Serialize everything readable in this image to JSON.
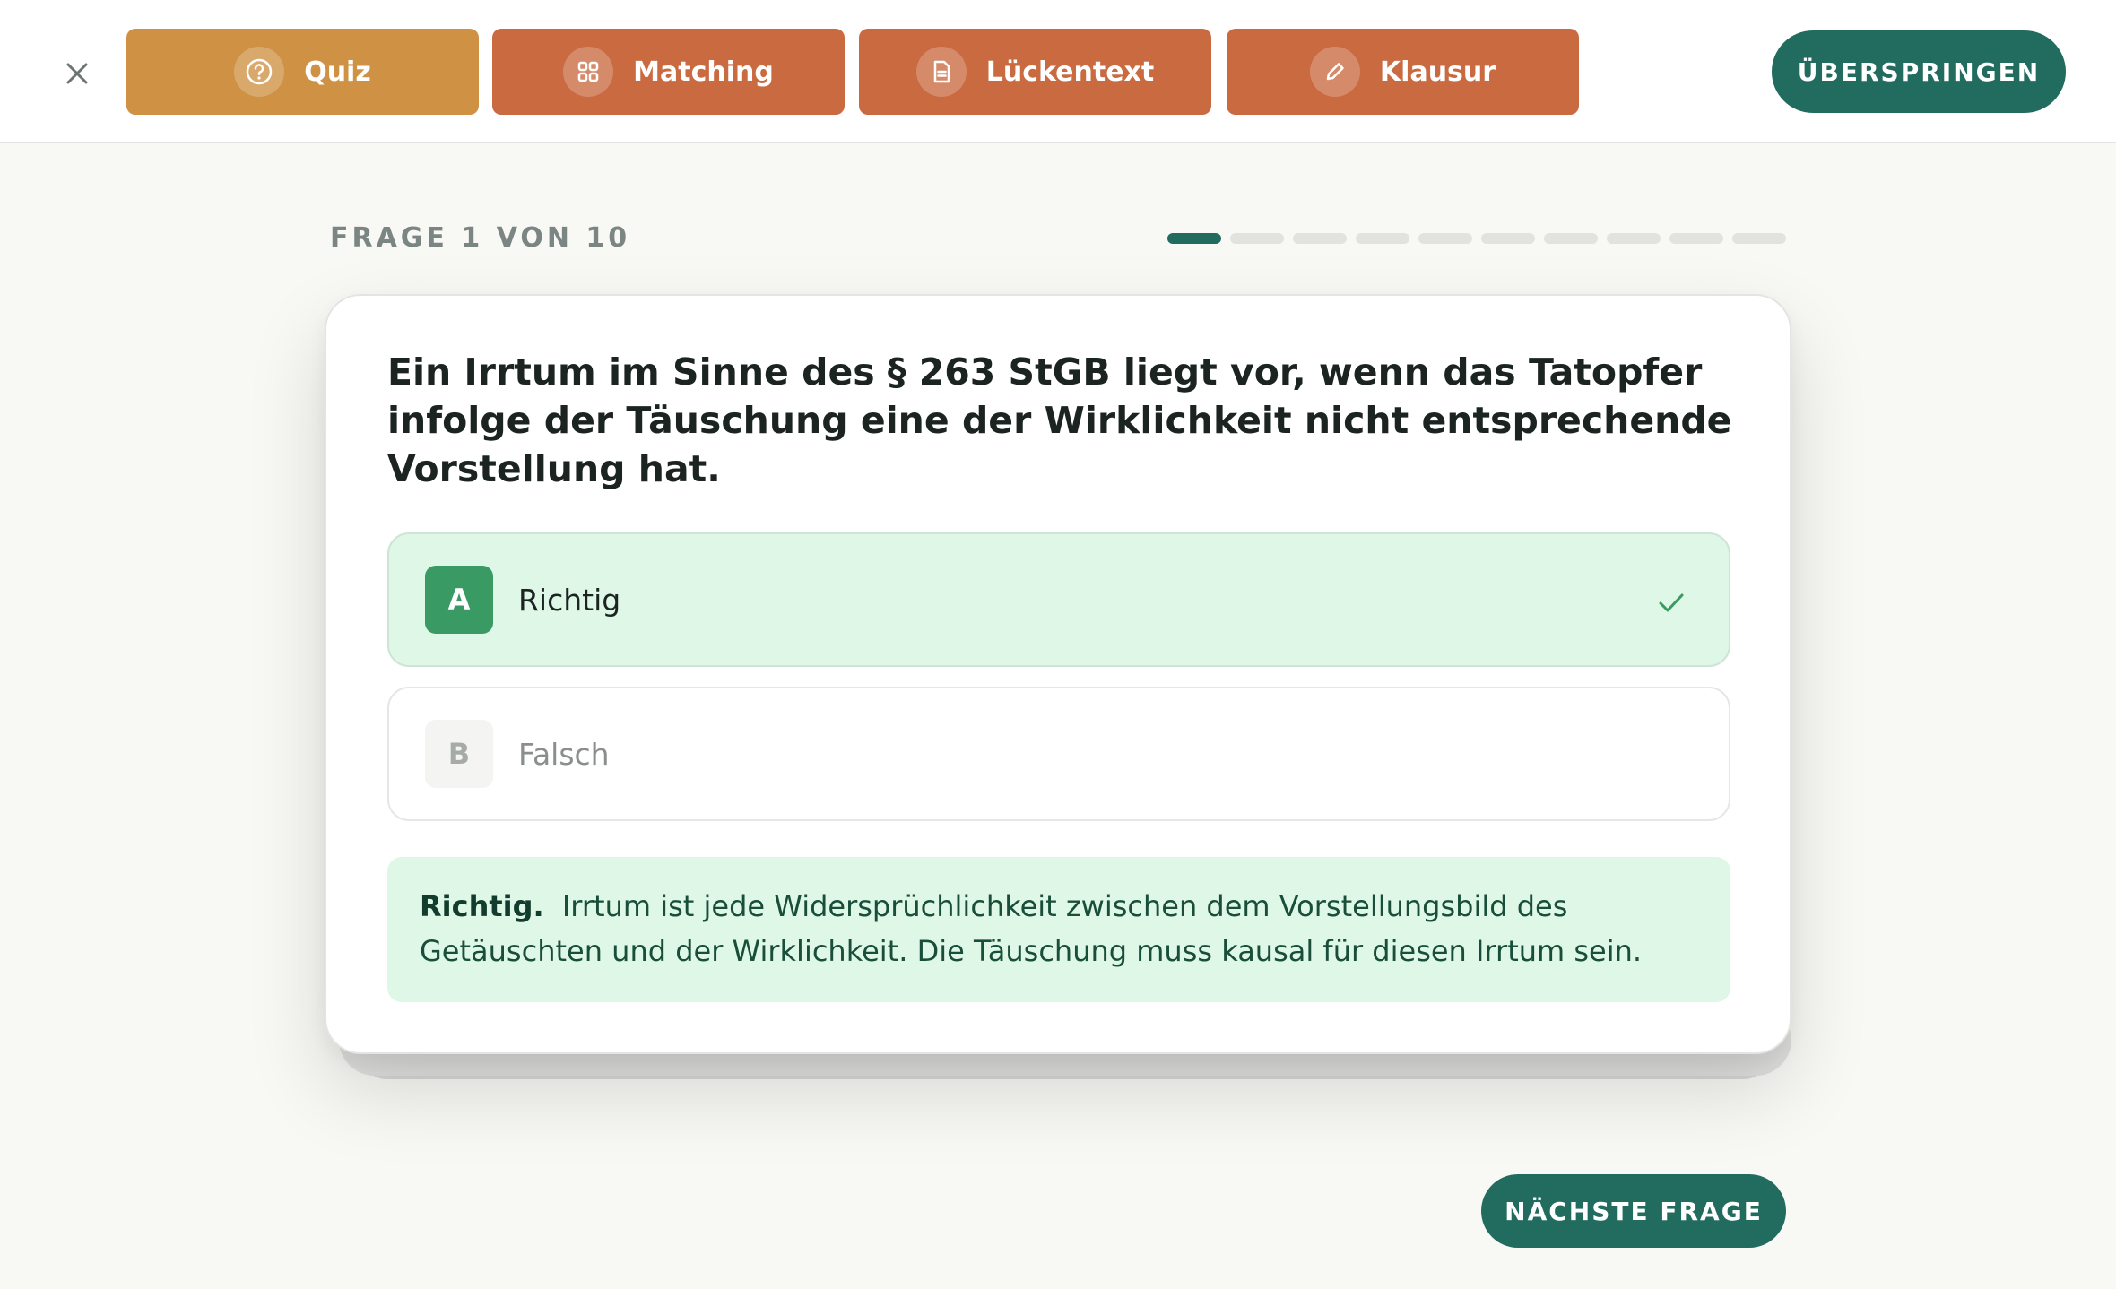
{
  "header": {
    "close_icon": "close-icon",
    "tabs": [
      {
        "label": "Quiz",
        "icon": "question-circle-icon",
        "active": true
      },
      {
        "label": "Matching",
        "icon": "grid-icon",
        "active": false
      },
      {
        "label": "Lückentext",
        "icon": "document-icon",
        "active": false
      },
      {
        "label": "Klausur",
        "icon": "pencil-icon",
        "active": false
      }
    ],
    "skip_label": "ÜBERSPRINGEN"
  },
  "progress": {
    "label": "FRAGE 1 VON 10",
    "current": 1,
    "total": 10
  },
  "question": {
    "text": "Ein Irrtum im Sinne des § 263 StGB liegt vor, wenn das Tatopfer infolge der Täuschung eine der Wirklichkeit nicht entsprechende Vorstellung hat.",
    "options": [
      {
        "letter": "A",
        "label": "Richtig",
        "state": "correct"
      },
      {
        "letter": "B",
        "label": "Falsch",
        "state": "unselected"
      }
    ]
  },
  "feedback": {
    "title": "Richtig.",
    "text": "Irrtum ist jede Widersprüchlichkeit zwischen dem Vorstellungsbild des Getäuschten und der Wirklichkeit. Die Täuschung muss kausal für diesen Irrtum sein."
  },
  "next_label": "NÄCHSTE FRAGE",
  "colors": {
    "primary": "#216b5f",
    "tab_active": "#cf9143",
    "tab_inactive": "#c96a40",
    "correct_bg": "#dff7e7",
    "correct_badge": "#3a9a63"
  }
}
